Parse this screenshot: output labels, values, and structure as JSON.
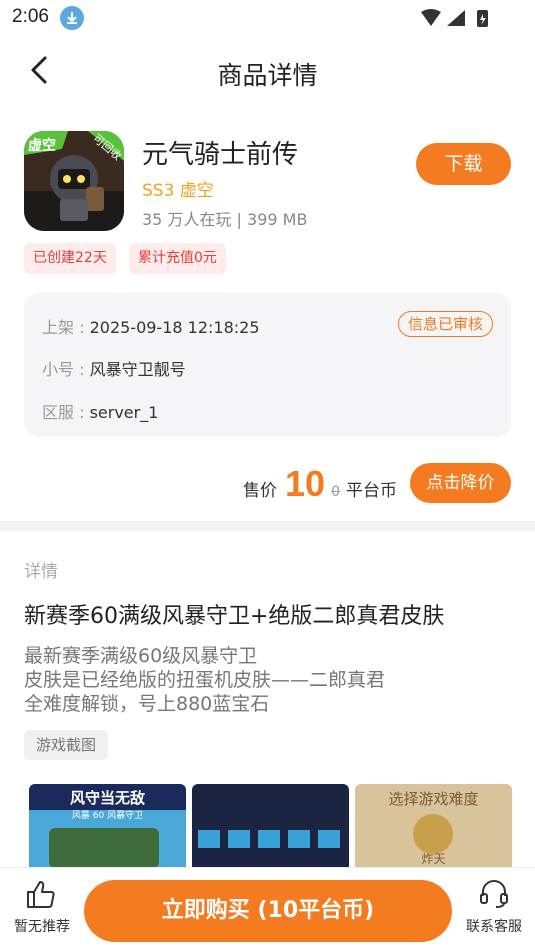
{
  "status": {
    "time": "2:06"
  },
  "nav": {
    "title": "商品详情"
  },
  "app": {
    "name": "元气骑士前传",
    "sub": "SS3 虚空",
    "meta": "35 万人在玩 | 399 MB",
    "download_label": "下载",
    "icon_badge_left": "虚空",
    "icon_badge_right": "可回收"
  },
  "tags": [
    "已创建22天",
    "累计充值0元"
  ],
  "info": {
    "rows": [
      {
        "label": "上架 : ",
        "value": "2025-09-18 12:18:25"
      },
      {
        "label": "小号 : ",
        "value": "风暴守卫靓号"
      },
      {
        "label": "区服 : ",
        "value": "server_1"
      }
    ],
    "verified": "信息已审核"
  },
  "price": {
    "label": "售价",
    "amount": "10",
    "original": "0",
    "unit": "平台币",
    "cut_label": "点击降价"
  },
  "detail": {
    "section_label": "详情",
    "title": "新赛季60满级风暴守卫+绝版二郎真君皮肤",
    "desc": [
      "最新赛季满级60级风暴守卫",
      "皮肤是已经绝版的扭蛋机皮肤——二郎真君",
      "全难度解锁，号上880蓝宝石"
    ],
    "screenshots_label": "游戏截图"
  },
  "screenshots": [
    {
      "caption": "风守当无敌",
      "sub": "风暴 60 风暴守卫"
    },
    {
      "caption": ""
    },
    {
      "caption": "选择游戏难度",
      "sub": "炸天"
    }
  ],
  "bottom": {
    "left_label": "暂无推荐",
    "buy_label": "立即购买 (10平台币)",
    "right_label": "联系客服"
  },
  "colors": {
    "accent": "#f47b20",
    "gold": "#f5a21b",
    "tag_red": "#e8403a"
  }
}
